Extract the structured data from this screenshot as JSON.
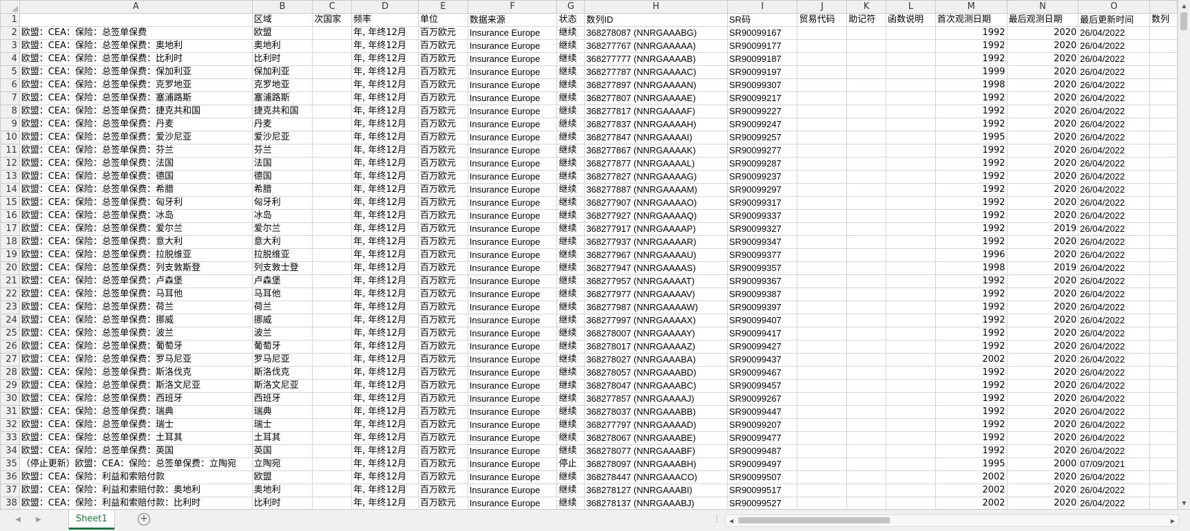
{
  "columns": [
    {
      "letter": "A",
      "width": 338
    },
    {
      "letter": "B",
      "width": 88
    },
    {
      "letter": "C",
      "width": 57
    },
    {
      "letter": "D",
      "width": 97
    },
    {
      "letter": "E",
      "width": 72
    },
    {
      "letter": "F",
      "width": 130
    },
    {
      "letter": "G",
      "width": 40
    },
    {
      "letter": "H",
      "width": 208
    },
    {
      "letter": "I",
      "width": 102
    },
    {
      "letter": "J",
      "width": 72
    },
    {
      "letter": "K",
      "width": 57
    },
    {
      "letter": "L",
      "width": 72
    },
    {
      "letter": "M",
      "width": 104
    },
    {
      "letter": "N",
      "width": 104
    },
    {
      "letter": "O",
      "width": 104
    },
    {
      "letter": "",
      "width": 40
    }
  ],
  "header_row": [
    "",
    "区域",
    "次国家",
    "频率",
    "单位",
    "数据来源",
    "状态",
    "数列ID",
    "SR码",
    "贸易代码",
    "助记符",
    "函数说明",
    "首次观测日期",
    "最后观测日期",
    "最后更新时间",
    "数列"
  ],
  "rows": [
    [
      "欧盟：CEA：保险：总签单保费",
      "欧盟",
      "",
      "年, 年终12月",
      "百万欧元",
      "Insurance Europe",
      "继续",
      "368278087 (NNRGAAABG)",
      "SR90099167",
      "",
      "",
      "",
      "1992",
      "2020",
      "26/04/2022"
    ],
    [
      "欧盟：CEA：保险：总签单保费：奥地利",
      "奥地利",
      "",
      "年, 年终12月",
      "百万欧元",
      "Insurance Europe",
      "继续",
      "368277767 (NNRGAAAAA)",
      "SR90099177",
      "",
      "",
      "",
      "1992",
      "2020",
      "26/04/2022"
    ],
    [
      "欧盟：CEA：保险：总签单保费：比利时",
      "比利时",
      "",
      "年, 年终12月",
      "百万欧元",
      "Insurance Europe",
      "继续",
      "368277777 (NNRGAAAAB)",
      "SR90099187",
      "",
      "",
      "",
      "1992",
      "2020",
      "26/04/2022"
    ],
    [
      "欧盟：CEA：保险：总签单保费：保加利亚",
      "保加利亚",
      "",
      "年, 年终12月",
      "百万欧元",
      "Insurance Europe",
      "继续",
      "368277787 (NNRGAAAAC)",
      "SR90099197",
      "",
      "",
      "",
      "1999",
      "2020",
      "26/04/2022"
    ],
    [
      "欧盟：CEA：保险：总签单保费：克罗地亚",
      "克罗地亚",
      "",
      "年, 年终12月",
      "百万欧元",
      "Insurance Europe",
      "继续",
      "368277897 (NNRGAAAAN)",
      "SR90099307",
      "",
      "",
      "",
      "1998",
      "2020",
      "26/04/2022"
    ],
    [
      "欧盟：CEA：保险：总签单保费：塞浦路斯",
      "塞浦路斯",
      "",
      "年, 年终12月",
      "百万欧元",
      "Insurance Europe",
      "继续",
      "368277807 (NNRGAAAAE)",
      "SR90099217",
      "",
      "",
      "",
      "1992",
      "2020",
      "26/04/2022"
    ],
    [
      "欧盟：CEA：保险：总签单保费：捷克共和国",
      "捷克共和国",
      "",
      "年, 年终12月",
      "百万欧元",
      "Insurance Europe",
      "继续",
      "368277817 (NNRGAAAAF)",
      "SR90099227",
      "",
      "",
      "",
      "1992",
      "2020",
      "26/04/2022"
    ],
    [
      "欧盟：CEA：保险：总签单保费：丹麦",
      "丹麦",
      "",
      "年, 年终12月",
      "百万欧元",
      "Insurance Europe",
      "继续",
      "368277837 (NNRGAAAAH)",
      "SR90099247",
      "",
      "",
      "",
      "1992",
      "2020",
      "26/04/2022"
    ],
    [
      "欧盟：CEA：保险：总签单保费：爱沙尼亚",
      "爱沙尼亚",
      "",
      "年, 年终12月",
      "百万欧元",
      "Insurance Europe",
      "继续",
      "368277847 (NNRGAAAAI)",
      "SR90099257",
      "",
      "",
      "",
      "1995",
      "2020",
      "26/04/2022"
    ],
    [
      "欧盟：CEA：保险：总签单保费：芬兰",
      "芬兰",
      "",
      "年, 年终12月",
      "百万欧元",
      "Insurance Europe",
      "继续",
      "368277867 (NNRGAAAAK)",
      "SR90099277",
      "",
      "",
      "",
      "1992",
      "2020",
      "26/04/2022"
    ],
    [
      "欧盟：CEA：保险：总签单保费：法国",
      "法国",
      "",
      "年, 年终12月",
      "百万欧元",
      "Insurance Europe",
      "继续",
      "368277877 (NNRGAAAAL)",
      "SR90099287",
      "",
      "",
      "",
      "1992",
      "2020",
      "26/04/2022"
    ],
    [
      "欧盟：CEA：保险：总签单保费：德国",
      "德国",
      "",
      "年, 年终12月",
      "百万欧元",
      "Insurance Europe",
      "继续",
      "368277827 (NNRGAAAAG)",
      "SR90099237",
      "",
      "",
      "",
      "1992",
      "2020",
      "26/04/2022"
    ],
    [
      "欧盟：CEA：保险：总签单保费：希腊",
      "希腊",
      "",
      "年, 年终12月",
      "百万欧元",
      "Insurance Europe",
      "继续",
      "368277887 (NNRGAAAAM)",
      "SR90099297",
      "",
      "",
      "",
      "1992",
      "2020",
      "26/04/2022"
    ],
    [
      "欧盟：CEA：保险：总签单保费：匈牙利",
      "匈牙利",
      "",
      "年, 年终12月",
      "百万欧元",
      "Insurance Europe",
      "继续",
      "368277907 (NNRGAAAAO)",
      "SR90099317",
      "",
      "",
      "",
      "1992",
      "2020",
      "26/04/2022"
    ],
    [
      "欧盟：CEA：保险：总签单保费：冰岛",
      "冰岛",
      "",
      "年, 年终12月",
      "百万欧元",
      "Insurance Europe",
      "继续",
      "368277927 (NNRGAAAAQ)",
      "SR90099337",
      "",
      "",
      "",
      "1992",
      "2020",
      "26/04/2022"
    ],
    [
      "欧盟：CEA：保险：总签单保费：爱尔兰",
      "爱尔兰",
      "",
      "年, 年终12月",
      "百万欧元",
      "Insurance Europe",
      "继续",
      "368277917 (NNRGAAAAP)",
      "SR90099327",
      "",
      "",
      "",
      "1992",
      "2019",
      "26/04/2022"
    ],
    [
      "欧盟：CEA：保险：总签单保费：意大利",
      "意大利",
      "",
      "年, 年终12月",
      "百万欧元",
      "Insurance Europe",
      "继续",
      "368277937 (NNRGAAAAR)",
      "SR90099347",
      "",
      "",
      "",
      "1992",
      "2020",
      "26/04/2022"
    ],
    [
      "欧盟：CEA：保险：总签单保费：拉脱维亚",
      "拉脱维亚",
      "",
      "年, 年终12月",
      "百万欧元",
      "Insurance Europe",
      "继续",
      "368277967 (NNRGAAAAU)",
      "SR90099377",
      "",
      "",
      "",
      "1996",
      "2020",
      "26/04/2022"
    ],
    [
      "欧盟：CEA：保险：总签单保费：列支敦斯登",
      "列支敦士登",
      "",
      "年, 年终12月",
      "百万欧元",
      "Insurance Europe",
      "继续",
      "368277947 (NNRGAAAAS)",
      "SR90099357",
      "",
      "",
      "",
      "1998",
      "2019",
      "26/04/2022"
    ],
    [
      "欧盟：CEA：保险：总签单保费：卢森堡",
      "卢森堡",
      "",
      "年, 年终12月",
      "百万欧元",
      "Insurance Europe",
      "继续",
      "368277957 (NNRGAAAAT)",
      "SR90099367",
      "",
      "",
      "",
      "1992",
      "2020",
      "26/04/2022"
    ],
    [
      "欧盟：CEA：保险：总签单保费：马耳他",
      "马耳他",
      "",
      "年, 年终12月",
      "百万欧元",
      "Insurance Europe",
      "继续",
      "368277977 (NNRGAAAAV)",
      "SR90099387",
      "",
      "",
      "",
      "1992",
      "2020",
      "26/04/2022"
    ],
    [
      "欧盟：CEA：保险：总签单保费：荷兰",
      "荷兰",
      "",
      "年, 年终12月",
      "百万欧元",
      "Insurance Europe",
      "继续",
      "368277987 (NNRGAAAAW)",
      "SR90099397",
      "",
      "",
      "",
      "1992",
      "2020",
      "26/04/2022"
    ],
    [
      "欧盟：CEA：保险：总签单保费：挪威",
      "挪威",
      "",
      "年, 年终12月",
      "百万欧元",
      "Insurance Europe",
      "继续",
      "368277997 (NNRGAAAAX)",
      "SR90099407",
      "",
      "",
      "",
      "1992",
      "2020",
      "26/04/2022"
    ],
    [
      "欧盟：CEA：保险：总签单保费：波兰",
      "波兰",
      "",
      "年, 年终12月",
      "百万欧元",
      "Insurance Europe",
      "继续",
      "368278007 (NNRGAAAAY)",
      "SR90099417",
      "",
      "",
      "",
      "1992",
      "2020",
      "26/04/2022"
    ],
    [
      "欧盟：CEA：保险：总签单保费：葡萄牙",
      "葡萄牙",
      "",
      "年, 年终12月",
      "百万欧元",
      "Insurance Europe",
      "继续",
      "368278017 (NNRGAAAAZ)",
      "SR90099427",
      "",
      "",
      "",
      "1992",
      "2020",
      "26/04/2022"
    ],
    [
      "欧盟：CEA：保险：总签单保费：罗马尼亚",
      "罗马尼亚",
      "",
      "年, 年终12月",
      "百万欧元",
      "Insurance Europe",
      "继续",
      "368278027 (NNRGAAABA)",
      "SR90099437",
      "",
      "",
      "",
      "2002",
      "2020",
      "26/04/2022"
    ],
    [
      "欧盟：CEA：保险：总签单保费：斯洛伐克",
      "斯洛伐克",
      "",
      "年, 年终12月",
      "百万欧元",
      "Insurance Europe",
      "继续",
      "368278057 (NNRGAAABD)",
      "SR90099467",
      "",
      "",
      "",
      "1992",
      "2020",
      "26/04/2022"
    ],
    [
      "欧盟：CEA：保险：总签单保费：斯洛文尼亚",
      "斯洛文尼亚",
      "",
      "年, 年终12月",
      "百万欧元",
      "Insurance Europe",
      "继续",
      "368278047 (NNRGAAABC)",
      "SR90099457",
      "",
      "",
      "",
      "1992",
      "2020",
      "26/04/2022"
    ],
    [
      "欧盟：CEA：保险：总签单保费：西班牙",
      "西班牙",
      "",
      "年, 年终12月",
      "百万欧元",
      "Insurance Europe",
      "继续",
      "368277857 (NNRGAAAAJ)",
      "SR90099267",
      "",
      "",
      "",
      "1992",
      "2020",
      "26/04/2022"
    ],
    [
      "欧盟：CEA：保险：总签单保费：瑞典",
      "瑞典",
      "",
      "年, 年终12月",
      "百万欧元",
      "Insurance Europe",
      "继续",
      "368278037 (NNRGAAABB)",
      "SR90099447",
      "",
      "",
      "",
      "1992",
      "2020",
      "26/04/2022"
    ],
    [
      "欧盟：CEA：保险：总签单保费：瑞士",
      "瑞士",
      "",
      "年, 年终12月",
      "百万欧元",
      "Insurance Europe",
      "继续",
      "368277797 (NNRGAAAAD)",
      "SR90099207",
      "",
      "",
      "",
      "1992",
      "2020",
      "26/04/2022"
    ],
    [
      "欧盟：CEA：保险：总签单保费：土耳其",
      "土耳其",
      "",
      "年, 年终12月",
      "百万欧元",
      "Insurance Europe",
      "继续",
      "368278067 (NNRGAAABE)",
      "SR90099477",
      "",
      "",
      "",
      "1992",
      "2020",
      "26/04/2022"
    ],
    [
      "欧盟：CEA：保险：总签单保费：英国",
      "英国",
      "",
      "年, 年终12月",
      "百万欧元",
      "Insurance Europe",
      "继续",
      "368278077 (NNRGAAABF)",
      "SR90099487",
      "",
      "",
      "",
      "1992",
      "2020",
      "26/04/2022"
    ],
    [
      "（停止更新）欧盟：CEA：保险：总签单保费：立陶宛",
      "立陶宛",
      "",
      "年, 年终12月",
      "百万欧元",
      "Insurance Europe",
      "停止",
      "368278097 (NNRGAAABH)",
      "SR90099497",
      "",
      "",
      "",
      "1995",
      "2000",
      "07/09/2021"
    ],
    [
      "欧盟：CEA：保险：利益和索赔付款",
      "欧盟",
      "",
      "年, 年终12月",
      "百万欧元",
      "Insurance Europe",
      "继续",
      "368278447 (NNRGAAACO)",
      "SR90099507",
      "",
      "",
      "",
      "2002",
      "2020",
      "26/04/2022"
    ],
    [
      "欧盟：CEA：保险：利益和索赔付款：奥地利",
      "奥地利",
      "",
      "年, 年终12月",
      "百万欧元",
      "Insurance Europe",
      "继续",
      "368278127 (NNRGAAABI)",
      "SR90099517",
      "",
      "",
      "",
      "2002",
      "2020",
      "26/04/2022"
    ],
    [
      "欧盟：CEA：保险：利益和索赔付款：比利时",
      "比利时",
      "",
      "年, 年终12月",
      "百万欧元",
      "Insurance Europe",
      "继续",
      "368278137 (NNRGAAABJ)",
      "SR90099527",
      "",
      "",
      "",
      "2002",
      "2020",
      "26/04/2022"
    ]
  ],
  "sheet_tab": "Sheet1",
  "icons": {
    "add_sheet": "plus-circle-icon",
    "nav_prev": "chevron-left-icon",
    "nav_next": "chevron-right-icon"
  },
  "colors": {
    "accent": "#217346",
    "header_bg": "#f0f0f0",
    "gridline": "#d4d4d4"
  }
}
